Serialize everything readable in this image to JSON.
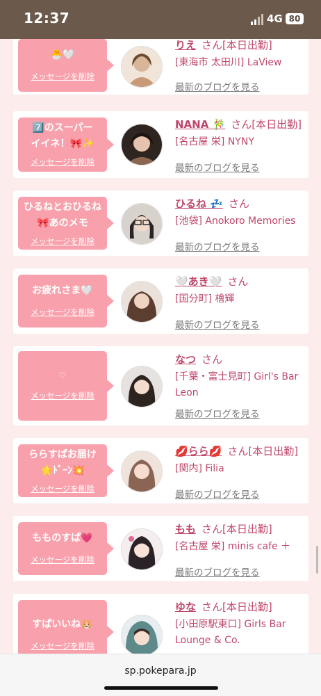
{
  "status_bar": {
    "time": "12:37",
    "network": "4G",
    "battery": "80"
  },
  "browser": {
    "url": "sp.pokepara.jp"
  },
  "delete_label": "メッセージを削除",
  "blog_label": "最新のブログを見る",
  "san_label": "さん",
  "cards": [
    {
      "message": "🐣🤍",
      "name": "りえ",
      "status": "[本日出勤]",
      "shop": "[東海市 太田川] LaView",
      "avatar_color": "#d9b59a"
    },
    {
      "message": "7️⃣のスーパーイイネ！🎀✨",
      "name": "NANA 🎋",
      "status": "[本日出勤]",
      "shop": "[名古屋 栄] NYNY",
      "avatar_color": "#5b4636"
    },
    {
      "message": "ひるねとおひるね🎀あのメモ",
      "name": "ひるね 💤",
      "status": "",
      "shop": "[池袋] Anokoro Memories",
      "avatar_color": "#3a3030"
    },
    {
      "message": "お疲れさま🤍",
      "name": "🤍あき🤍",
      "status": "",
      "shop": "[国分町] 檜輝",
      "avatar_color": "#6b4a3a"
    },
    {
      "message": "♡",
      "name": "なつ",
      "status": "",
      "shop": "[千葉・富士見町] Girl's Bar Leon",
      "avatar_color": "#4a3b35"
    },
    {
      "message": "ららすぱお届け🌟ﾄﾞｰﾝ💥",
      "name": "💋らら💋",
      "status": "[本日出勤]",
      "shop": "[関内] Filia",
      "avatar_color": "#b58c7a"
    },
    {
      "message": "もものすぱ💗",
      "name": "もも",
      "status": "[本日出勤]",
      "shop": "[名古屋 栄] minis cafe ＋",
      "avatar_color": "#c9b4a8"
    },
    {
      "message": "すぱいいね🐹",
      "name": "ゆな",
      "status": "[本日出勤]",
      "shop": "[小田原駅東口] Girls Bar Lounge & Co.",
      "avatar_color": "#5f8a8b"
    }
  ]
}
